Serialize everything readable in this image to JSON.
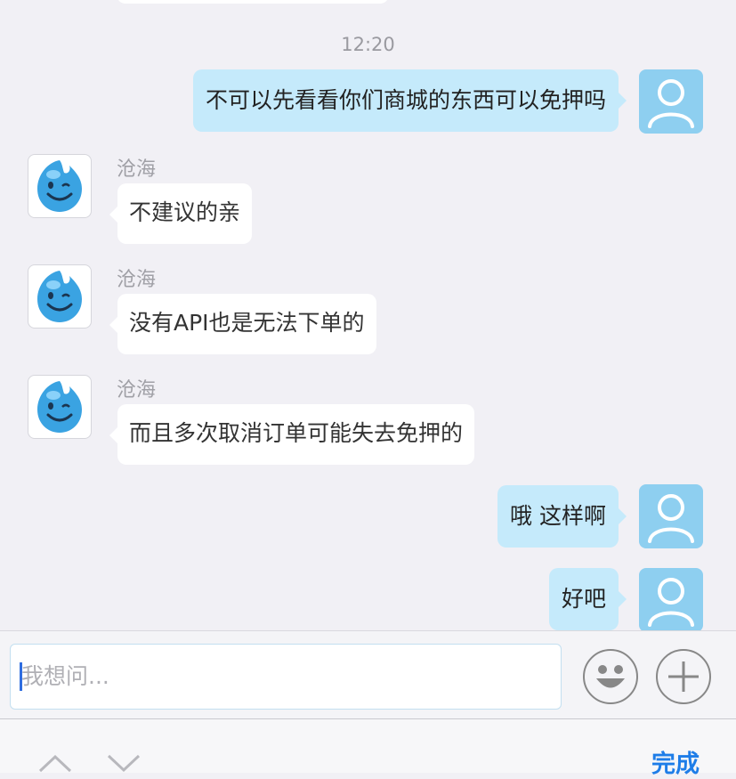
{
  "timestamp": "12:20",
  "messages": [
    {
      "side": "out",
      "text": "不可以先看看你们商城的东西可以免押吗"
    },
    {
      "side": "in",
      "sender": "沧海",
      "text": "不建议的亲"
    },
    {
      "side": "in",
      "sender": "沧海",
      "text": "没有API也是无法下单的"
    },
    {
      "side": "in",
      "sender": "沧海",
      "text": "而且多次取消订单可能失去免押的"
    },
    {
      "side": "out",
      "text": "哦 这样啊"
    },
    {
      "side": "out",
      "text": "好吧"
    }
  ],
  "input": {
    "placeholder": "我想问..."
  },
  "toolbar": {
    "done_label": "完成"
  },
  "icons": {
    "user_avatar": "user-silhouette-icon",
    "agent_avatar": "winking-water-drop-mascot",
    "emoji": "smiley-face-icon",
    "plus": "plus-icon",
    "prev": "chevron-up-icon",
    "next": "chevron-down-icon"
  },
  "colors": {
    "background": "#f1f0f5",
    "outgoing_bubble": "#c5eafb",
    "incoming_bubble": "#ffffff",
    "accent": "#1e7de8",
    "user_avatar_bg": "#8ecff0"
  }
}
